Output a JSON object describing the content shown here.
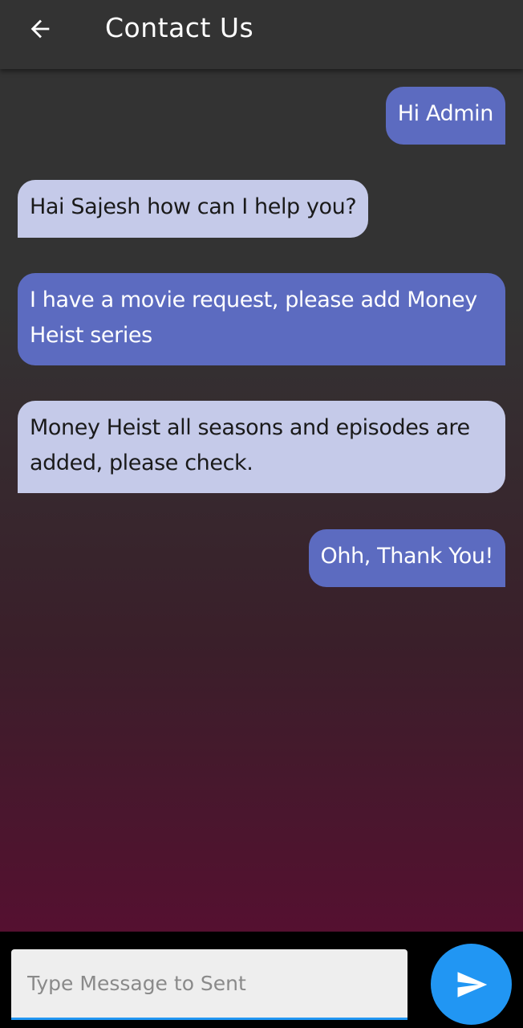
{
  "app_bar": {
    "title": "Contact Us",
    "back_icon": "arrow-left-icon"
  },
  "messages": [
    {
      "sender": "user",
      "text": "Hi Admin"
    },
    {
      "sender": "admin",
      "text": "Hai Sajesh how can I help you?"
    },
    {
      "sender": "user",
      "text": "I have a movie request, please add Money Heist series"
    },
    {
      "sender": "admin",
      "text": "Money Heist all seasons and episodes are added, please check."
    },
    {
      "sender": "user",
      "text": "Ohh, Thank You!"
    }
  ],
  "composer": {
    "placeholder": "Type Message to Sent",
    "value": "",
    "send_icon": "send-icon"
  },
  "colors": {
    "app_bar": "#333333",
    "sent_bubble": "#5c6bc0",
    "received_bubble": "#c5cae9",
    "accent": "#2196f3"
  }
}
